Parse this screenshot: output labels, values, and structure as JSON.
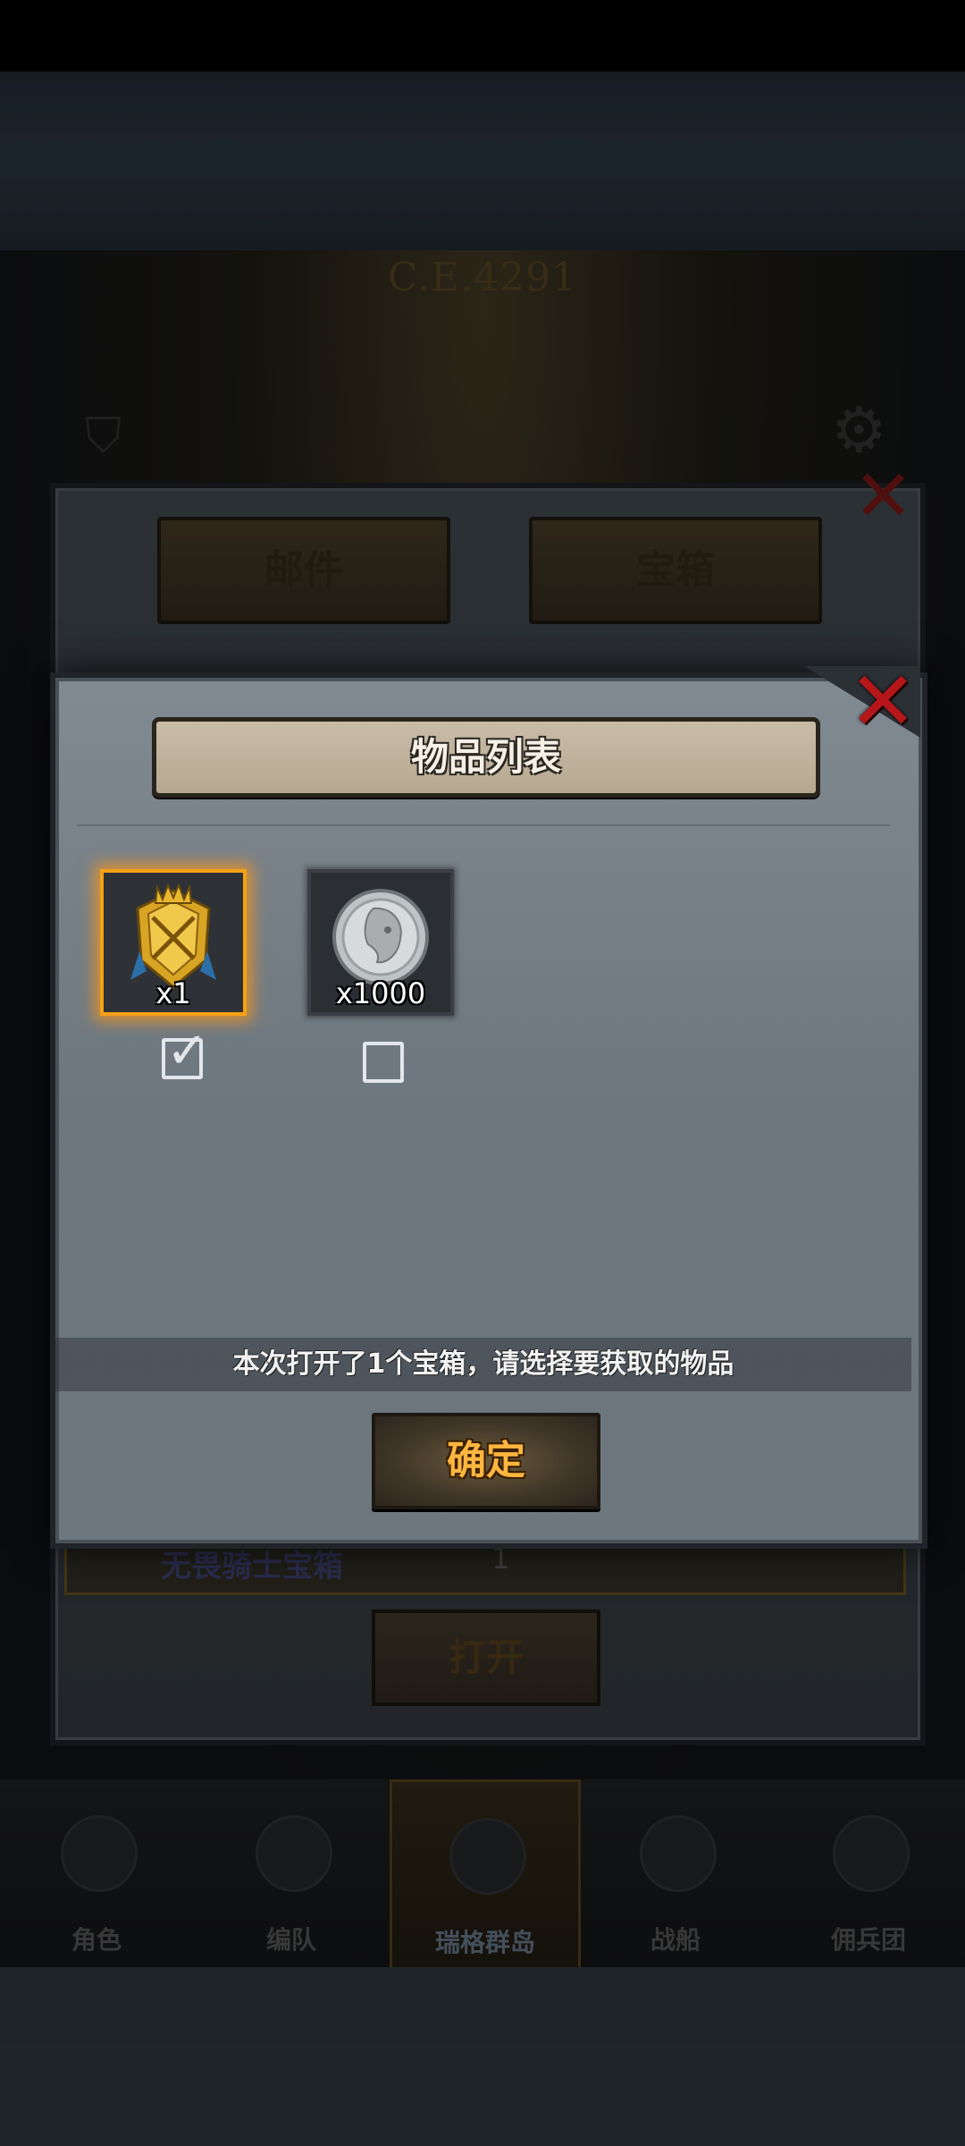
{
  "background": {
    "chapter_label": "C.E.4291",
    "mail_panel": {
      "tabs": [
        "邮件",
        "宝箱"
      ],
      "row_title": "无畏骑士宝箱",
      "row_count": "1",
      "open_button": "打开"
    },
    "bottom_nav": [
      {
        "label": "角色"
      },
      {
        "label": "编队"
      },
      {
        "label": "瑞格群岛"
      },
      {
        "label": "战船"
      },
      {
        "label": "佣兵团"
      }
    ]
  },
  "modal": {
    "title": "物品列表",
    "items": [
      {
        "name": "golden-crest",
        "qty": "x1",
        "selected": true
      },
      {
        "name": "silver-coin",
        "qty": "x1000",
        "selected": false
      }
    ],
    "instruction": "本次打开了1个宝箱，请选择要获取的物品",
    "confirm_label": "确定"
  },
  "colors": {
    "selected_glow": "#f5a116",
    "close_red": "#b5161a",
    "confirm_text": "#ffb640"
  },
  "icons": [
    "close-icon",
    "golden-crest-icon",
    "silver-coin-icon",
    "checkbox-checked-icon",
    "checkbox-empty-icon",
    "gear-icon"
  ]
}
